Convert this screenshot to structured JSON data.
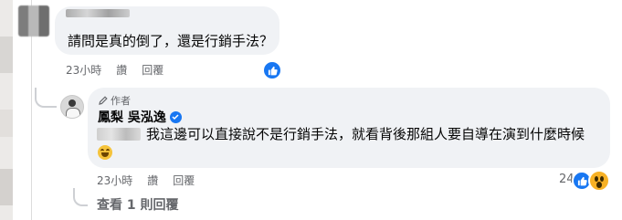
{
  "comment1": {
    "text": "請問是真的倒了，還是行銷手法？",
    "time": "23小時",
    "like_label": "讚",
    "reply_label": "回覆"
  },
  "reply": {
    "badge": "作者",
    "author": "鳳梨 吳泓逸",
    "text": "我這邊可以直接說不是行銷手法，就看背後那組人要自導在演到什麼時候",
    "time": "23小時",
    "like_label": "讚",
    "reply_label": "回覆",
    "reaction_count": "24"
  },
  "view_replies": "查看 1 則回覆",
  "colors": {
    "bubble": "#f0f2f5",
    "like_blue": "#1877f2",
    "meta_gray": "#65676b",
    "wow_yellow": "#f7b125"
  },
  "icons": [
    "like-icon",
    "wow-icon",
    "pencil-icon",
    "verified-icon",
    "grin-emoji-icon"
  ]
}
